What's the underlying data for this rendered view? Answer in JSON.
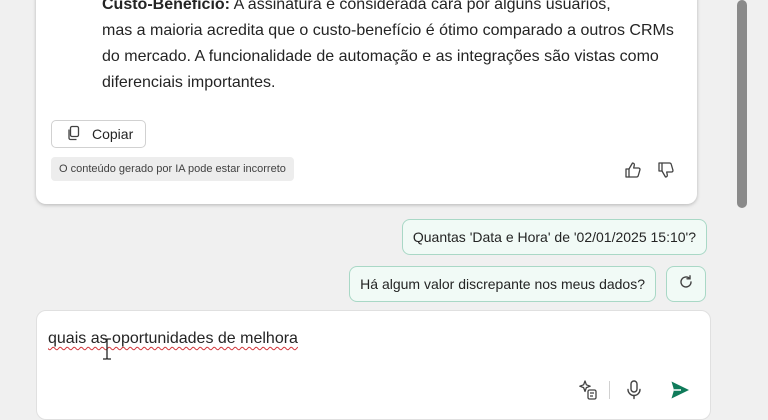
{
  "response": {
    "heading_cut": "Custo-Benefício:",
    "first_line_cut": " A assinatura é considerada cara por alguns usuários,",
    "body_rest": "mas a maioria acredita que o custo-benefício é ótimo comparado a outros CRMs do mercado. A funcionalidade de automação e as integrações são vistas como diferenciais importantes.",
    "copy_label": "Copiar",
    "disclaimer": "O conteúdo gerado por IA pode estar incorreto"
  },
  "suggestions": [
    "Quantas 'Data e Hora' de '02/01/2025 15:10'?",
    "Há algum valor discrepante nos meus dados?"
  ],
  "composer": {
    "value": "quais as oportunidades de melhora"
  },
  "icons": {
    "copy": "copy-icon",
    "thumbs_up": "thumbs-up-icon",
    "thumbs_down": "thumbs-down-icon",
    "refresh": "refresh-icon",
    "prompt": "sparkle-prompt-icon",
    "mic": "microphone-icon",
    "send": "send-icon"
  },
  "colors": {
    "accent": "#0f7b5a",
    "bubble_border": "#a9d8c6",
    "bubble_bg": "#f1faf6"
  }
}
